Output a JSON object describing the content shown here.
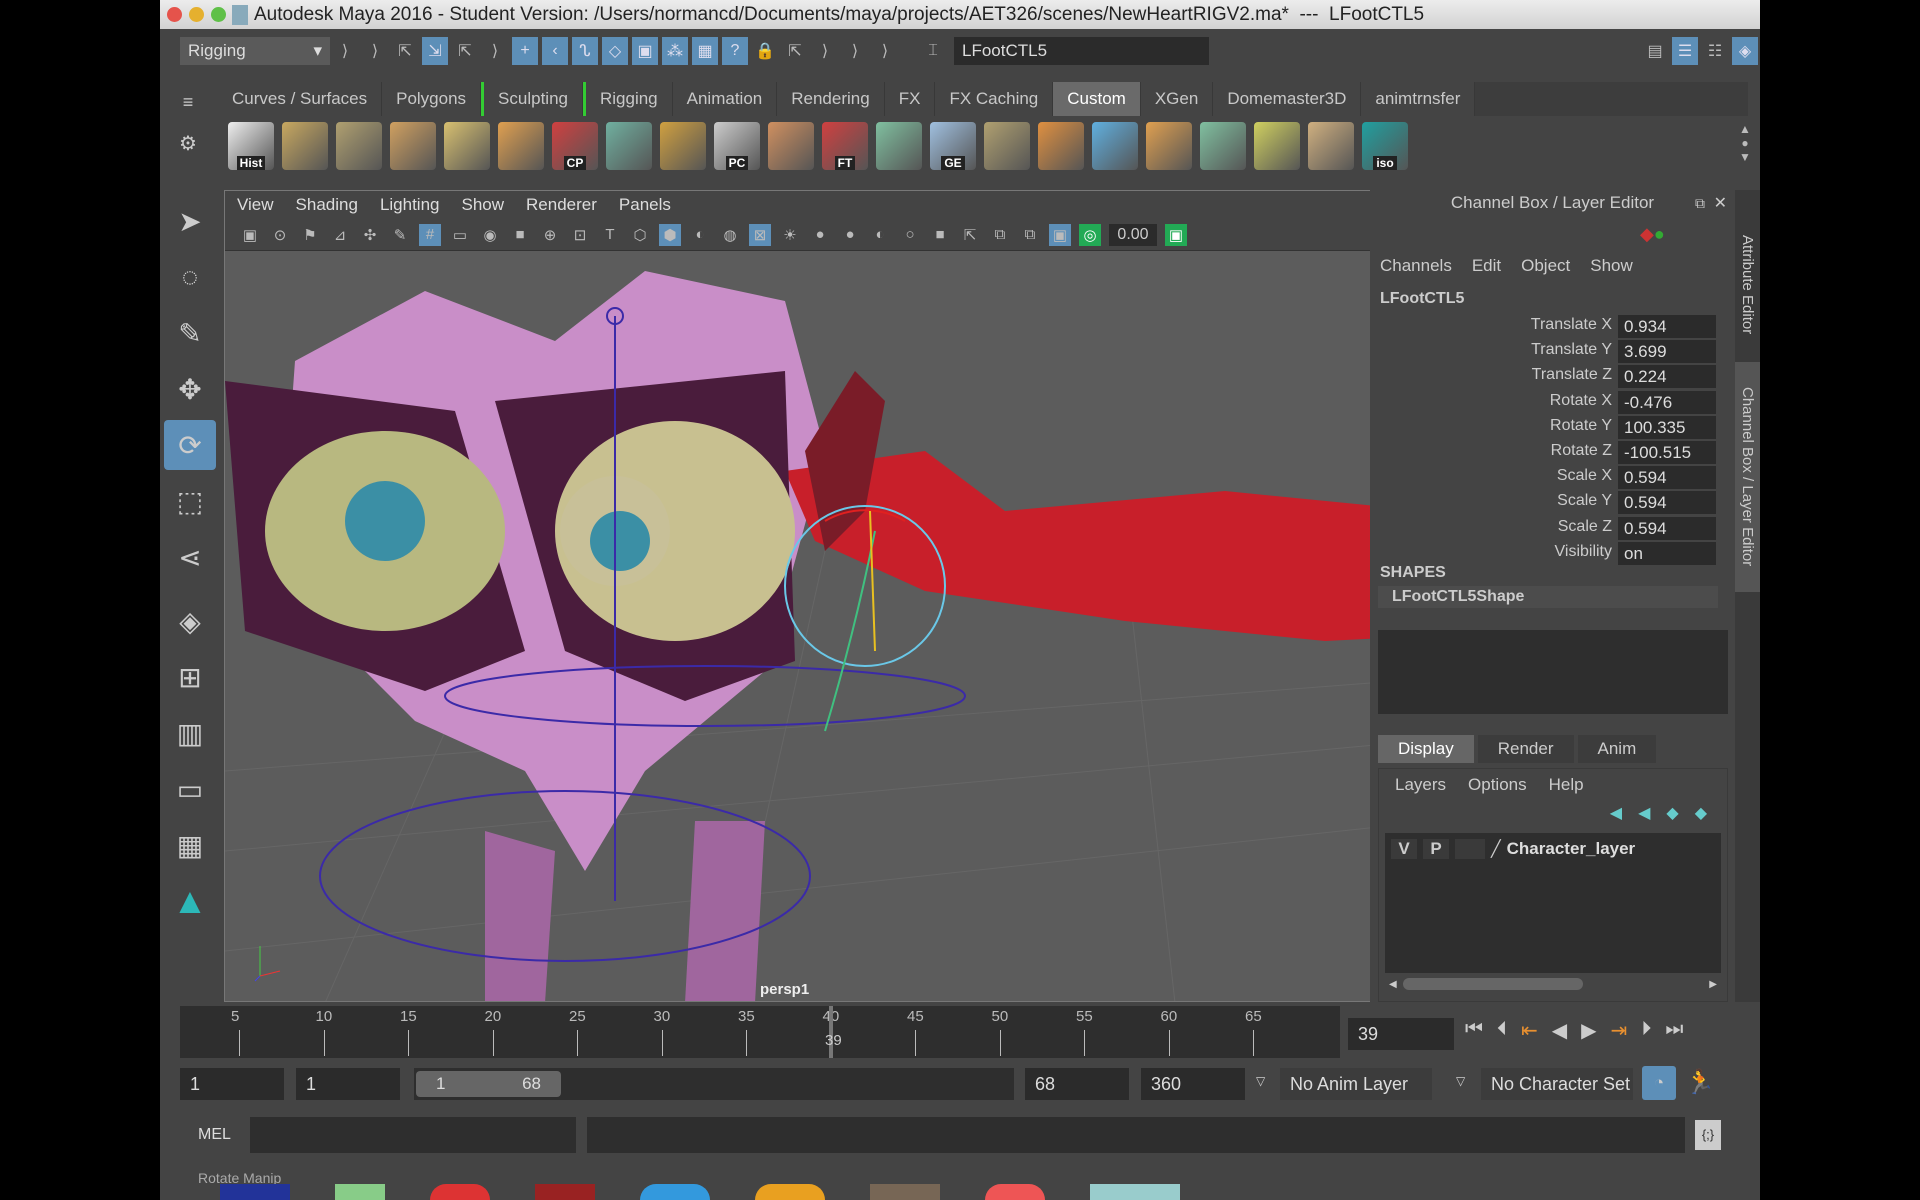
{
  "window": {
    "title": "Autodesk Maya 2016 - Student Version: /Users/normancd/Documents/maya/projects/AET326/scenes/NewHeartRIGV2.ma*  ---  LFootCTL5"
  },
  "status_line": {
    "menu_set": "Rigging",
    "object_name": "LFootCTL5"
  },
  "shelf_tabs": [
    {
      "label": "Curves / Surfaces"
    },
    {
      "label": "Polygons"
    },
    {
      "label": "Sculpting"
    },
    {
      "label": "Rigging"
    },
    {
      "label": "Animation"
    },
    {
      "label": "Rendering"
    },
    {
      "label": "FX"
    },
    {
      "label": "FX Caching"
    },
    {
      "label": "Custom",
      "active": true
    },
    {
      "label": "XGen"
    },
    {
      "label": "Domemaster3D"
    },
    {
      "label": "animtrnsfer"
    }
  ],
  "shelf_icons": [
    {
      "name": "hist",
      "label": "Hist",
      "color": "#eeeeee"
    },
    {
      "name": "lattice",
      "label": "",
      "color": "#c8a860"
    },
    {
      "name": "plane",
      "label": "",
      "color": "#b0a070"
    },
    {
      "name": "pencil",
      "label": "",
      "color": "#d0a060"
    },
    {
      "name": "uv",
      "label": "",
      "color": "#d8c070"
    },
    {
      "name": "box",
      "label": "",
      "color": "#e0a050"
    },
    {
      "name": "cp",
      "label": "CP",
      "color": "#d04040"
    },
    {
      "name": "window",
      "label": "",
      "color": "#70b0a0"
    },
    {
      "name": "grid",
      "label": "",
      "color": "#d0a040"
    },
    {
      "name": "pc",
      "label": "PC",
      "color": "#cccccc"
    },
    {
      "name": "curve",
      "label": "",
      "color": "#d09060"
    },
    {
      "name": "ft",
      "label": "FT",
      "color": "#d04040"
    },
    {
      "name": "checker",
      "label": "",
      "color": "#80c0a0"
    },
    {
      "name": "ge",
      "label": "GE",
      "color": "#a0c0e0"
    },
    {
      "name": "plane2",
      "label": "",
      "color": "#b0a070"
    },
    {
      "name": "bricks",
      "label": "",
      "color": "#e09040"
    },
    {
      "name": "brush",
      "label": "",
      "color": "#60b0e0"
    },
    {
      "name": "layers",
      "label": "",
      "color": "#e0a050"
    },
    {
      "name": "checker2",
      "label": "",
      "color": "#80c0a0"
    },
    {
      "name": "paint",
      "label": "",
      "color": "#d0d060"
    },
    {
      "name": "bbox",
      "label": "",
      "color": "#d0b080"
    },
    {
      "name": "iso",
      "label": "iso",
      "color": "#20a0a0"
    }
  ],
  "viewport": {
    "menus": [
      "View",
      "Shading",
      "Lighting",
      "Show",
      "Renderer",
      "Panels"
    ],
    "exposure": "0.00",
    "camera": "persp1"
  },
  "channel_box": {
    "title": "Channel Box / Layer Editor",
    "menus": [
      "Channels",
      "Edit",
      "Object",
      "Show"
    ],
    "object": "LFootCTL5",
    "channels": [
      {
        "label": "Translate X",
        "value": "0.934"
      },
      {
        "label": "Translate Y",
        "value": "3.699"
      },
      {
        "label": "Translate Z",
        "value": "0.224"
      },
      {
        "label": "Rotate X",
        "value": "-0.476"
      },
      {
        "label": "Rotate Y",
        "value": "100.335"
      },
      {
        "label": "Rotate Z",
        "value": "-100.515"
      },
      {
        "label": "Scale X",
        "value": "0.594"
      },
      {
        "label": "Scale Y",
        "value": "0.594"
      },
      {
        "label": "Scale Z",
        "value": "0.594"
      },
      {
        "label": "Visibility",
        "value": "on"
      }
    ],
    "shapes_header": "SHAPES",
    "shape": "LFootCTL5Shape"
  },
  "layer_editor": {
    "tabs": [
      "Display",
      "Render",
      "Anim"
    ],
    "menus": [
      "Layers",
      "Options",
      "Help"
    ],
    "layer": {
      "v": "V",
      "p": "P",
      "name": "Character_layer"
    }
  },
  "side_tabs": [
    "Attribute Editor",
    "Channel Box / Layer Editor"
  ],
  "time_slider": {
    "ticks": [
      "5",
      "10",
      "15",
      "20",
      "25",
      "30",
      "35",
      "40",
      "45",
      "50",
      "55",
      "60",
      "65"
    ],
    "current_frame": "39",
    "current_field": "39"
  },
  "range_slider": {
    "start": "1",
    "playback_start": "1",
    "range_start": "1",
    "range_end": "68",
    "playback_end": "68",
    "end": "360",
    "anim_layer": "No Anim Layer",
    "character_set": "No Character Set"
  },
  "command_line": {
    "label": "MEL"
  },
  "help_line": "Rotate Manip"
}
